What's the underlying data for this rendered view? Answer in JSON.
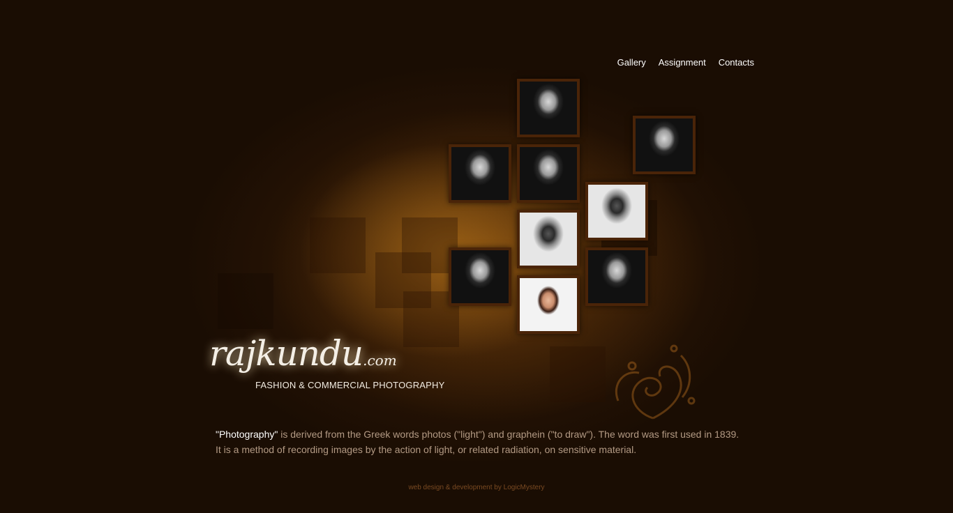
{
  "nav": {
    "items": [
      "Gallery",
      "Assignment",
      "Contacts"
    ]
  },
  "logo": {
    "name": "rajkundu",
    "tld": ".com",
    "tagline": "FASHION & COMMERCIAL PHOTOGRAPHY"
  },
  "description": {
    "highlight": "\"Photography\"",
    "line1_rest": " is derived from the Greek words photos (\"light\") and graphein (\"to draw\"). The word was first used in 1839.",
    "line2": "It is a method of recording images by the action of light, or related radiation, on sensitive material."
  },
  "footer": {
    "credit": "web design & development by LogicMystery"
  },
  "colors": {
    "background": "#1a0d03",
    "accent": "#c9821e",
    "frame": "#4a2408"
  }
}
